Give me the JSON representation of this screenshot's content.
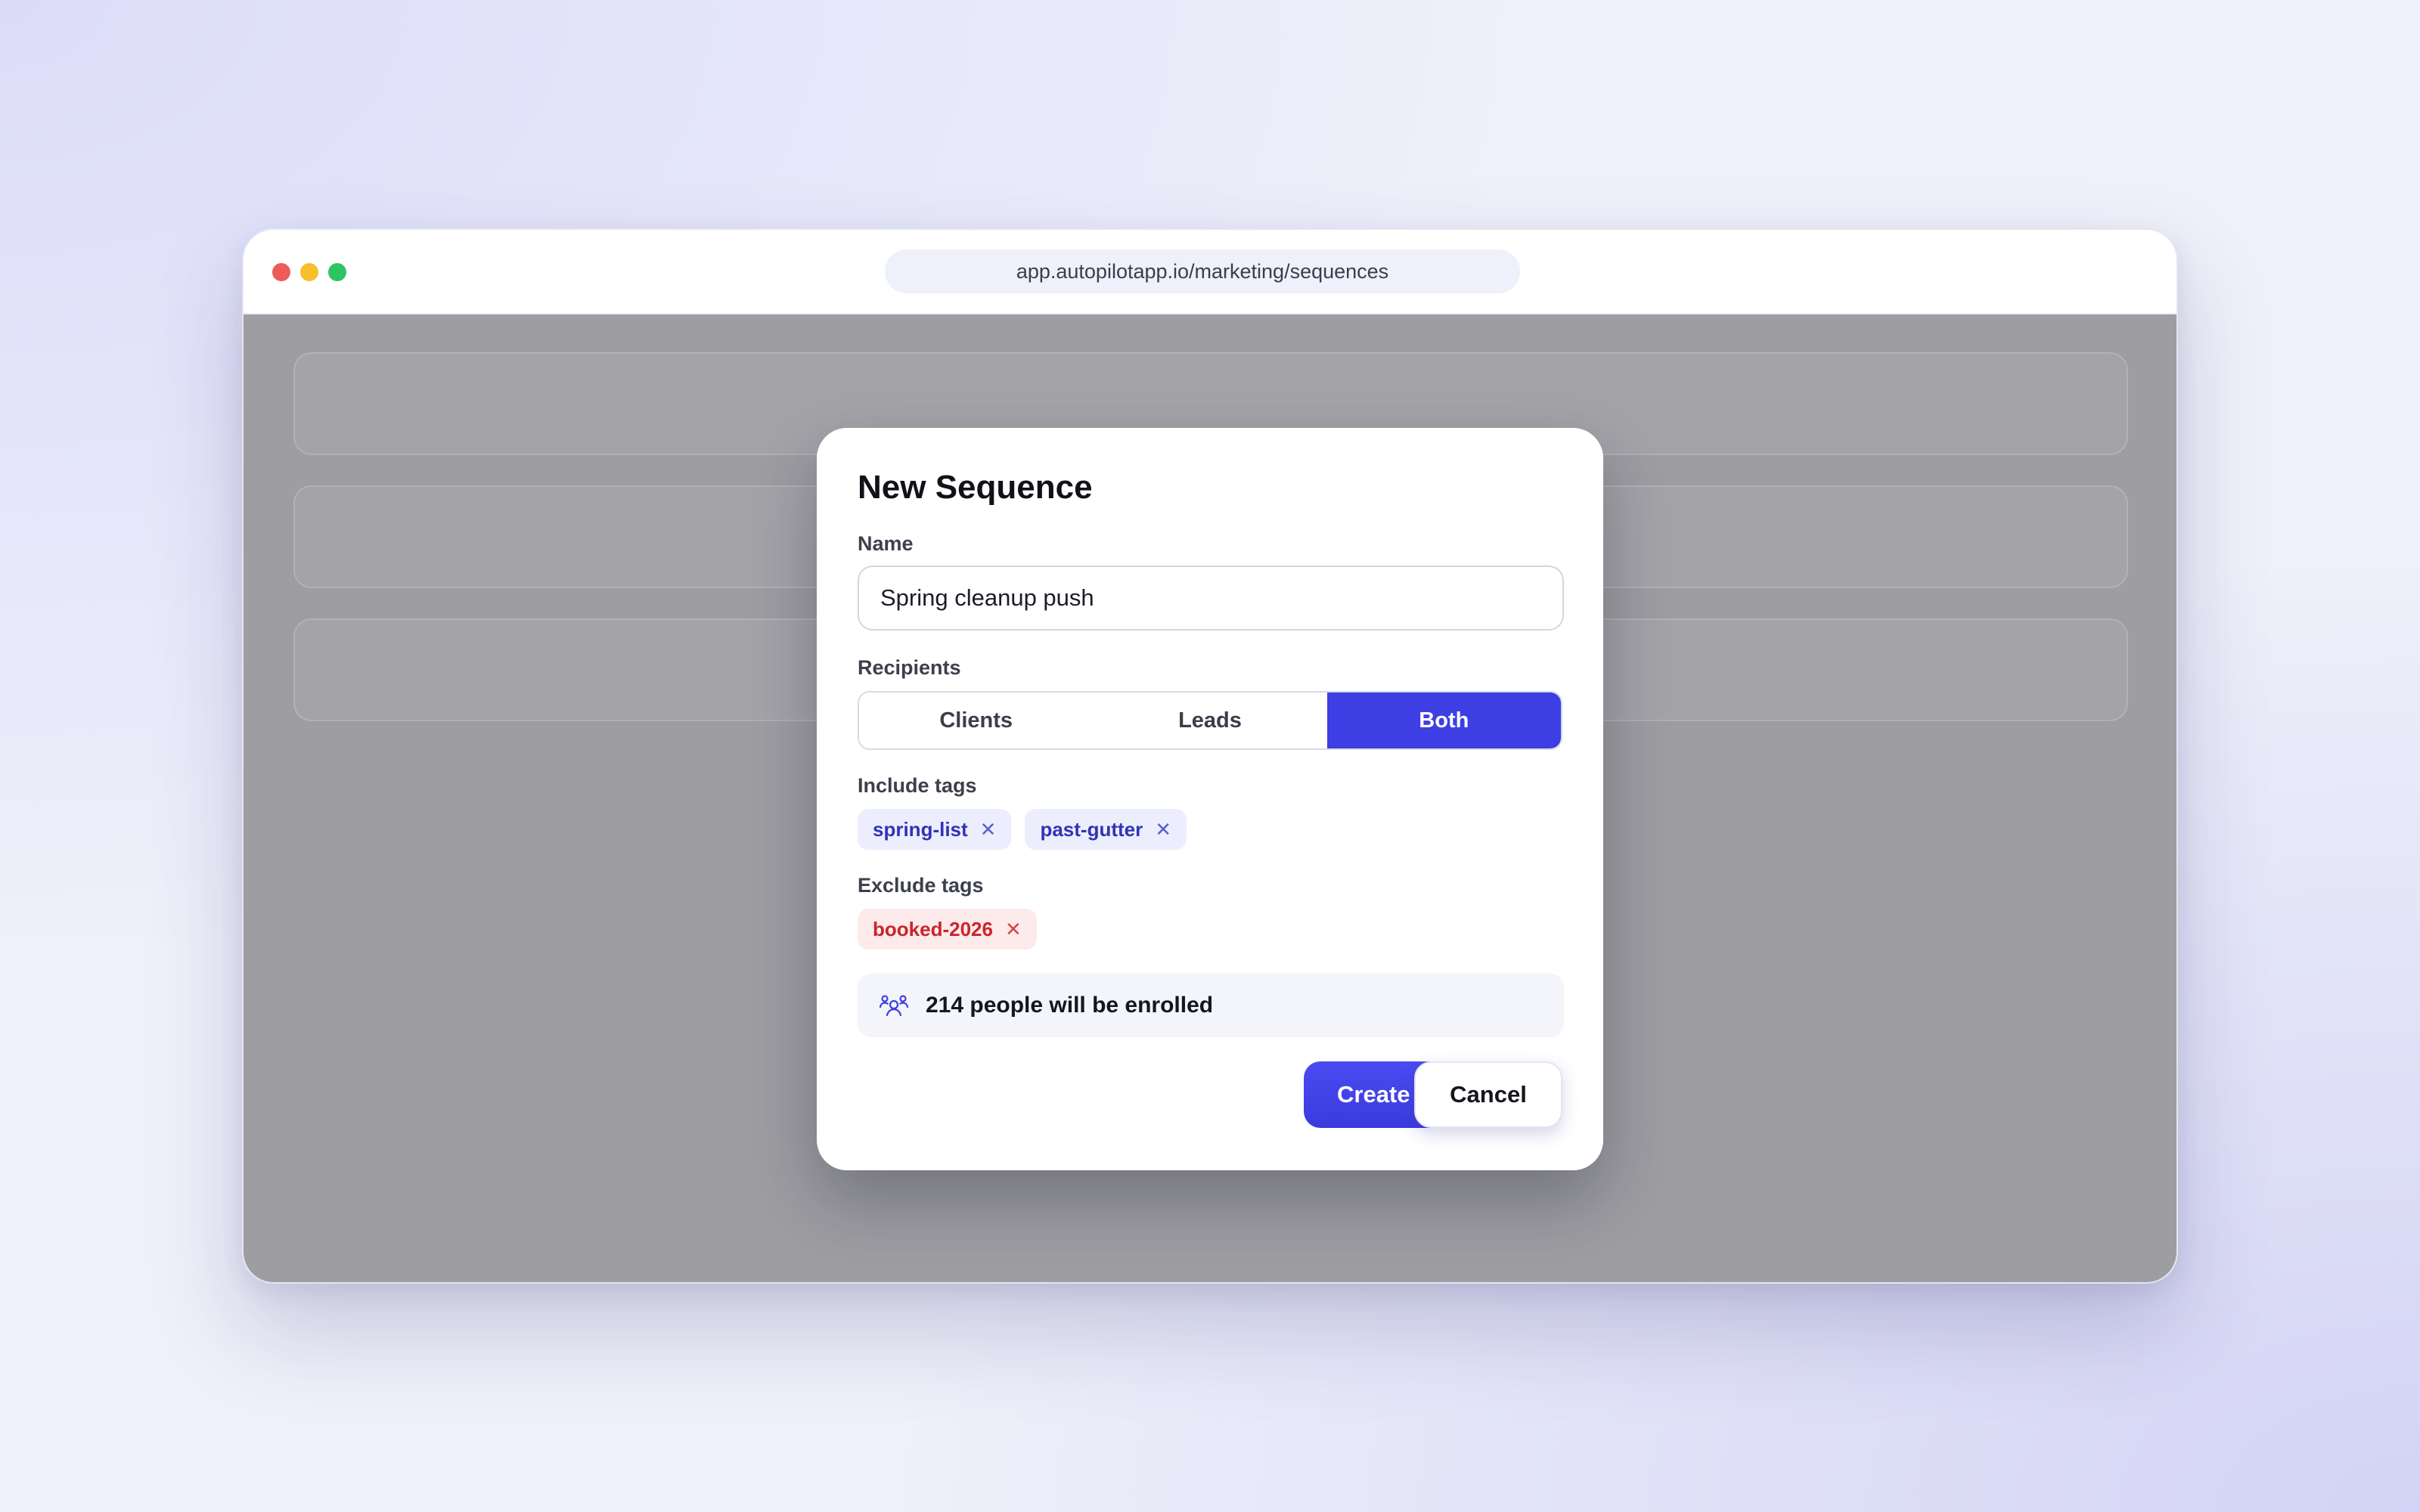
{
  "browser": {
    "url": "app.autopilotapp.io/marketing/sequences"
  },
  "modal": {
    "title": "New Sequence",
    "name_label": "Name",
    "name_value": "Spring cleanup push",
    "recipients_label": "Recipients",
    "recipients_options": [
      "Clients",
      "Leads",
      "Both"
    ],
    "recipients_selected": "Both",
    "include_tags_label": "Include tags",
    "include_tags": [
      "spring-list",
      "past-gutter"
    ],
    "exclude_tags_label": "Exclude tags",
    "exclude_tags": [
      "booked-2026"
    ],
    "enrollment_text": "214 people will be enrolled",
    "create_label": "Create",
    "cancel_label": "Cancel"
  },
  "icons": {
    "enroll": "people-group-icon",
    "remove_tag": "close-icon"
  },
  "colors": {
    "accent": "#3d3ee3",
    "include_tag_bg": "#eceefd",
    "include_tag_text": "#3033b5",
    "exclude_tag_bg": "#fdeaea",
    "exclude_tag_text": "#c8262b",
    "overlay": "#9d9da2"
  }
}
